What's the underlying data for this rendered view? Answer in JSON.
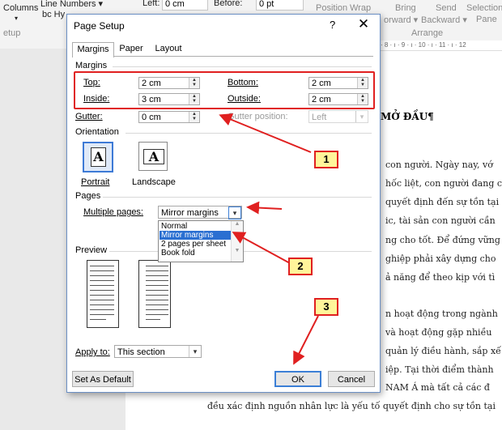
{
  "ribbon": {
    "columns": "Columns",
    "line_numbers": "Line Numbers",
    "hyphenation": "bc Hy",
    "left_label": "Left:",
    "left_value": "0 cm",
    "before_label": "Before:",
    "before_value": "0 pt",
    "position": "Position",
    "wrap": "Wrap",
    "bring": "Bring",
    "forward": "orward",
    "send": "Send",
    "backward": "Backward",
    "selection": "Selection",
    "pane": "Pane",
    "arrange": "Arrange",
    "setup": "etup",
    "ruler": "· 8 · ı · 9 · ı · 10 · ı · 11 · ı · 12"
  },
  "document": {
    "heading": "MỞ ĐẦU¶",
    "lines": [
      "con người. Ngày nay, vớ",
      "hốc liệt, con người đang c",
      "quyết định đến sự tồn tại",
      "ic, tài sản con người cần",
      "ng cho tốt. Để đứng vững",
      "ghiệp phải xây dựng cho",
      "ả năng để theo kịp với tì",
      "n hoạt động trong ngành",
      "và hoạt động gặp nhiều",
      "quản lý điều hành, sắp xế",
      "iệp. Tại thời điểm thành",
      "NAM Á mà tất cả các đ",
      "đều xác định nguồn nhân lực là yếu tố quyết định cho sự tồn tại"
    ]
  },
  "dialog": {
    "title": "Page Setup",
    "help": "?",
    "close": "✕",
    "tabs": [
      "Margins",
      "Paper",
      "Layout"
    ],
    "margins_section": "Margins",
    "top_label": "Top:",
    "top_value": "2 cm",
    "bottom_label": "Bottom:",
    "bottom_value": "2 cm",
    "inside_label": "Inside:",
    "inside_value": "3 cm",
    "outside_label": "Outside:",
    "outside_value": "2 cm",
    "gutter_label": "Gutter:",
    "gutter_value": "0 cm",
    "gutter_position_label": "Gutter position:",
    "gutter_position_value": "Left",
    "orientation_section": "Orientation",
    "portrait": "Portrait",
    "landscape": "Landscape",
    "pages_section": "Pages",
    "multiple_pages_label": "Multiple pages:",
    "multiple_pages_value": "Mirror margins",
    "multiple_pages_options": [
      "Normal",
      "Mirror margins",
      "2 pages per sheet",
      "Book fold"
    ],
    "preview_section": "Preview",
    "apply_to_label": "Apply to:",
    "apply_to_value": "This section",
    "set_default": "Set As Default",
    "ok": "OK",
    "cancel": "Cancel"
  },
  "callouts": [
    "1",
    "2",
    "3"
  ],
  "colors": {
    "annotation_red": "#e02020",
    "callout_fill": "#fff59a",
    "selection_blue": "#2a6fd1"
  }
}
